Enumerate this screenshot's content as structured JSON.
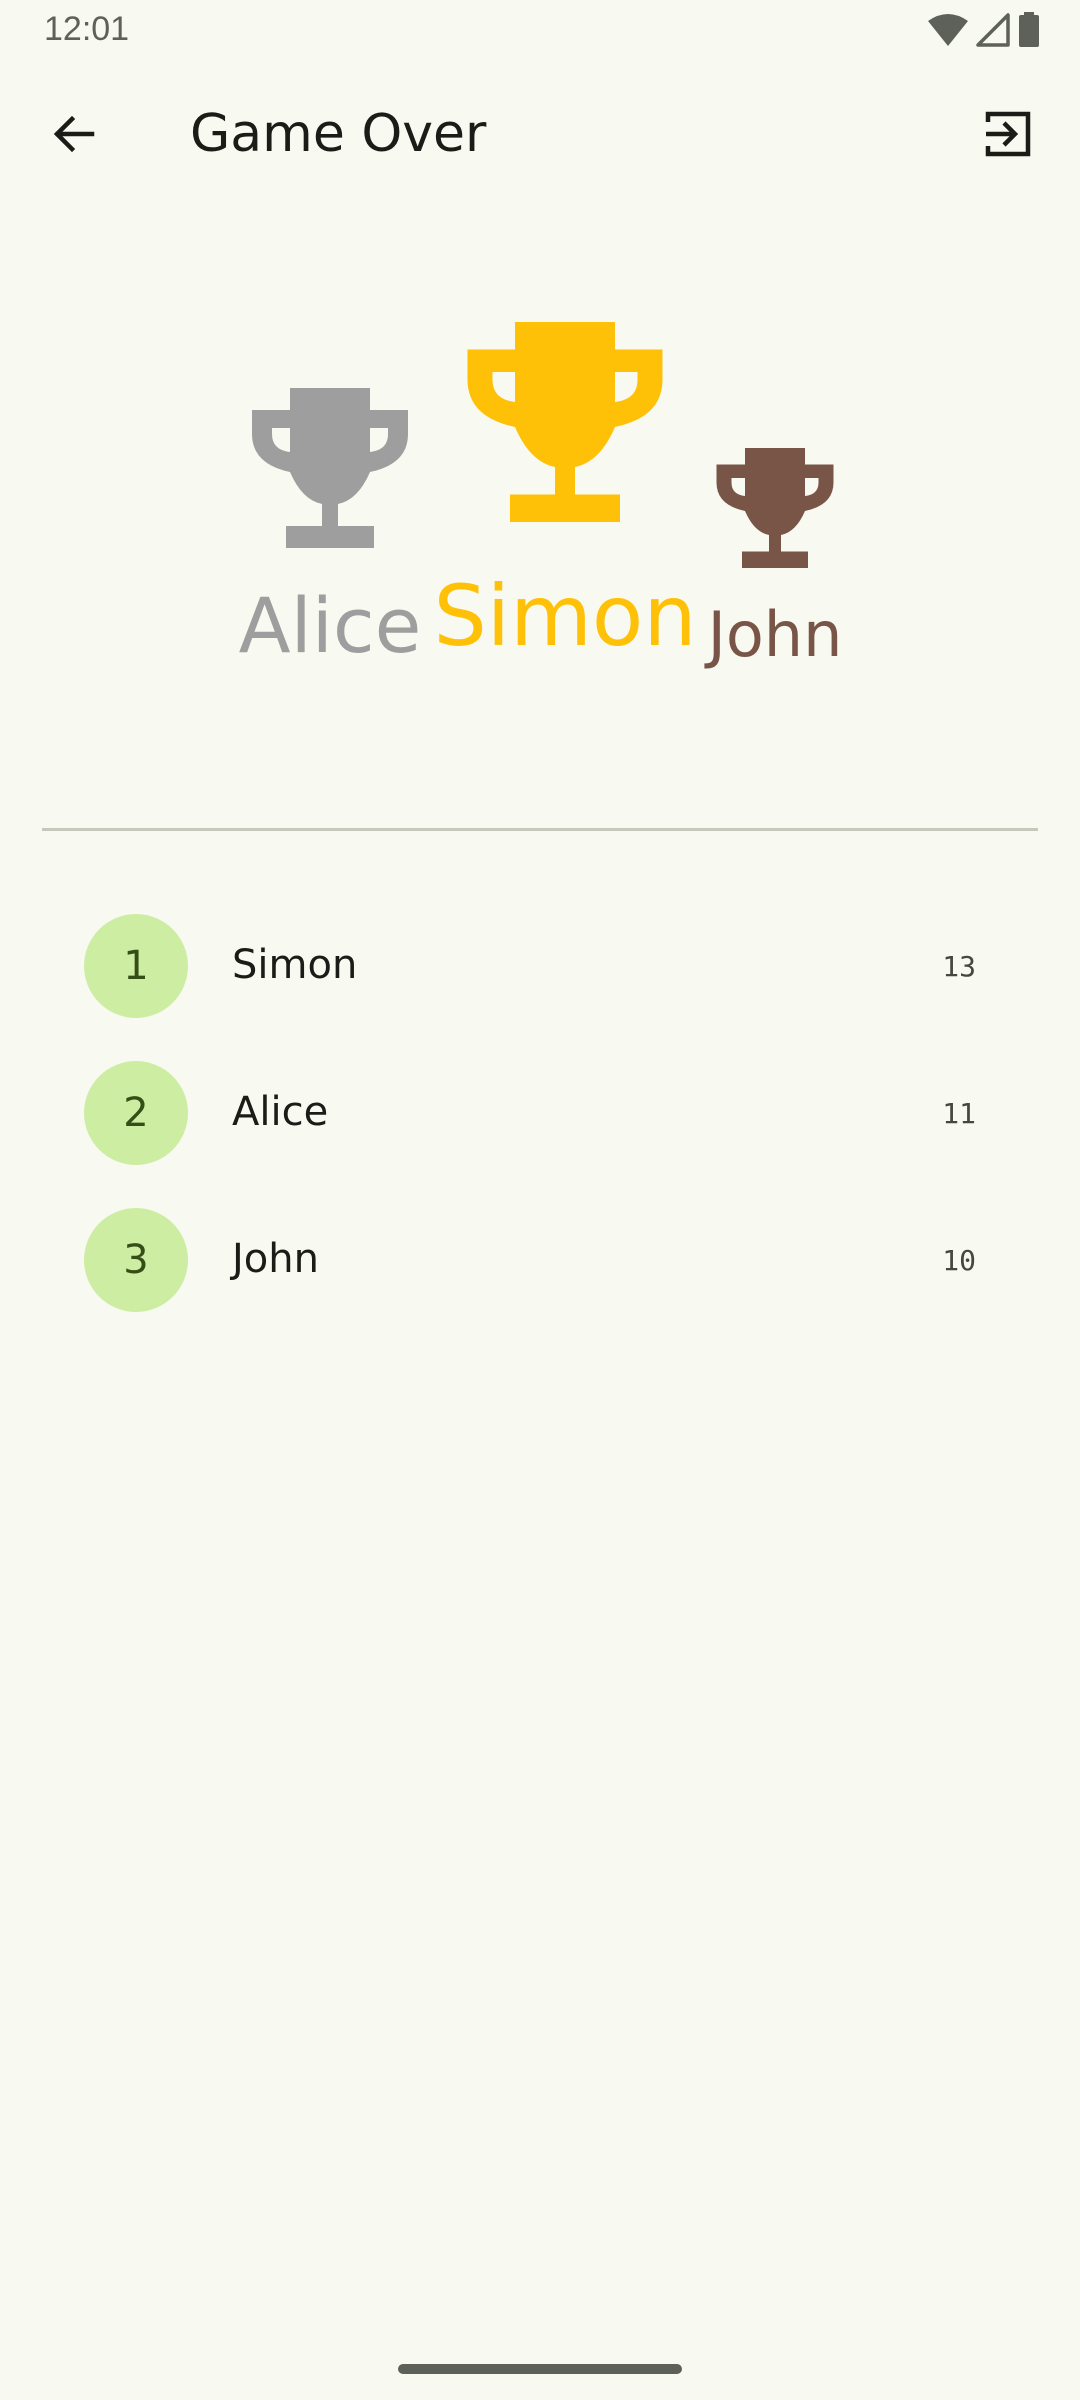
{
  "status_bar": {
    "time": "12:01",
    "icons": [
      "wifi-icon",
      "signal-icon",
      "battery-icon"
    ]
  },
  "app_bar": {
    "title": "Game Over",
    "back_icon": "arrow-back-icon",
    "exit_icon": "exit-to-app-icon"
  },
  "podium": {
    "first": {
      "name": "Simon",
      "color": "#FFC107",
      "icon": "trophy-icon"
    },
    "second": {
      "name": "Alice",
      "color": "#9E9E9E",
      "icon": "trophy-icon"
    },
    "third": {
      "name": "John",
      "color": "#795548",
      "icon": "trophy-icon"
    }
  },
  "ranking": [
    {
      "rank": "1",
      "name": "Simon",
      "score": "13"
    },
    {
      "rank": "2",
      "name": "Alice",
      "score": "11"
    },
    {
      "rank": "3",
      "name": "John",
      "score": "10"
    }
  ],
  "colors": {
    "background": "#F8F9F0",
    "rank_badge": "#CDEDA3",
    "rank_badge_text": "#354E16",
    "divider": "#C7C8BB"
  }
}
